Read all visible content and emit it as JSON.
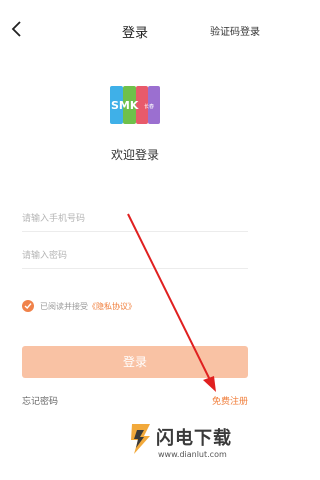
{
  "header": {
    "back_icon": "chevron-left-icon",
    "title": "登录",
    "sms_login_label": "验证码登录"
  },
  "brand": {
    "logo_text": "SMK",
    "logo_sub": "长春"
  },
  "welcome_text": "欢迎登录",
  "form": {
    "phone_placeholder": "请输入手机号码",
    "password_placeholder": "请输入密码",
    "agree_text": "已阅读并接受",
    "privacy_link": "《隐私协议》",
    "agree_checked": true,
    "login_label": "登录",
    "forgot_label": "忘记密码",
    "register_label": "免费注册"
  },
  "watermark": {
    "name": "闪电下载",
    "url": "www.dianlut.com"
  },
  "colors": {
    "accent": "#f07d3a",
    "button_bg": "#f9c2a4",
    "arrow": "#e02020"
  }
}
